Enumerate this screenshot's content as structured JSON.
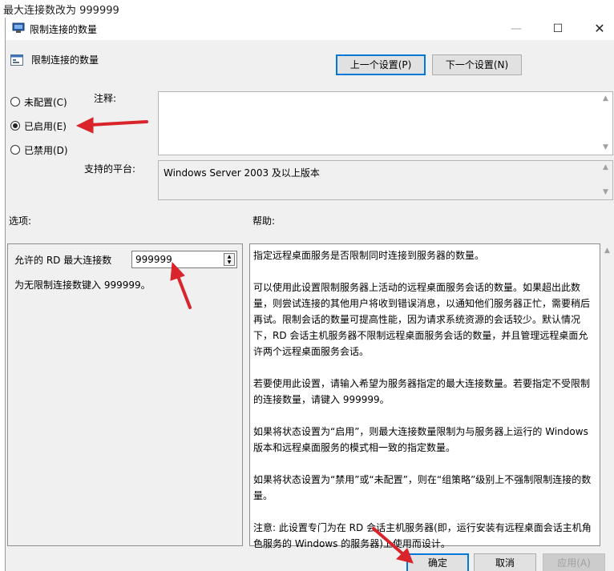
{
  "caption": "最大连接数改为 999999",
  "window": {
    "title": "限制连接的数量",
    "minimize": "—",
    "maximize": "☐",
    "close": "✕"
  },
  "header": {
    "title": "限制连接的数量"
  },
  "nav": {
    "prev": "上一个设置(P)",
    "next": "下一个设置(N)"
  },
  "state_options": [
    {
      "label": "未配置(C)",
      "selected": false
    },
    {
      "label": "已启用(E)",
      "selected": true
    },
    {
      "label": "已禁用(D)",
      "selected": false
    }
  ],
  "comment": {
    "label": "注释:",
    "value": ""
  },
  "platform": {
    "label": "支持的平台:",
    "value": "Windows Server 2003 及以上版本"
  },
  "options_label": "选项:",
  "help_label": "帮助:",
  "options": {
    "max_connections_label": "允许的 RD 最大连接数",
    "max_connections_value": "999999",
    "hint": "为无限制连接数键入 999999。"
  },
  "help_paragraphs": [
    "指定远程桌面服务是否限制同时连接到服务器的数量。",
    "可以使用此设置限制服务器上活动的远程桌面服务会话的数量。如果超出此数量，则尝试连接的其他用户将收到错误消息，以通知他们服务器正忙，需要稍后再试。限制会话的数量可提高性能，因为请求系统资源的会话较少。默认情况下，RD 会话主机服务器不限制远程桌面服务会话的数量，并且管理远程桌面允许两个远程桌面服务会话。",
    "若要使用此设置，请输入希望为服务器指定的最大连接数量。若要指定不受限制的连接数量，请键入 999999。",
    "如果将状态设置为“启用”，则最大连接数量限制为与服务器上运行的 Windows 版本和远程桌面服务的模式相一致的指定数量。",
    "如果将状态设置为“禁用”或“未配置”，则在“组策略”级别上不强制限制连接的数量。",
    "注意: 此设置专门为在 RD 会话主机服务器(即，运行安装有远程桌面会话主机角色服务的 Windows 的服务器)上使用而设计。"
  ],
  "footer": {
    "ok": "确定",
    "cancel": "取消",
    "apply": "应用(A)"
  },
  "colors": {
    "annotation_arrow": "#d9242b",
    "accent": "#0078d7"
  },
  "icons": {
    "title": "policy-icon",
    "header": "policy-setting-icon"
  }
}
